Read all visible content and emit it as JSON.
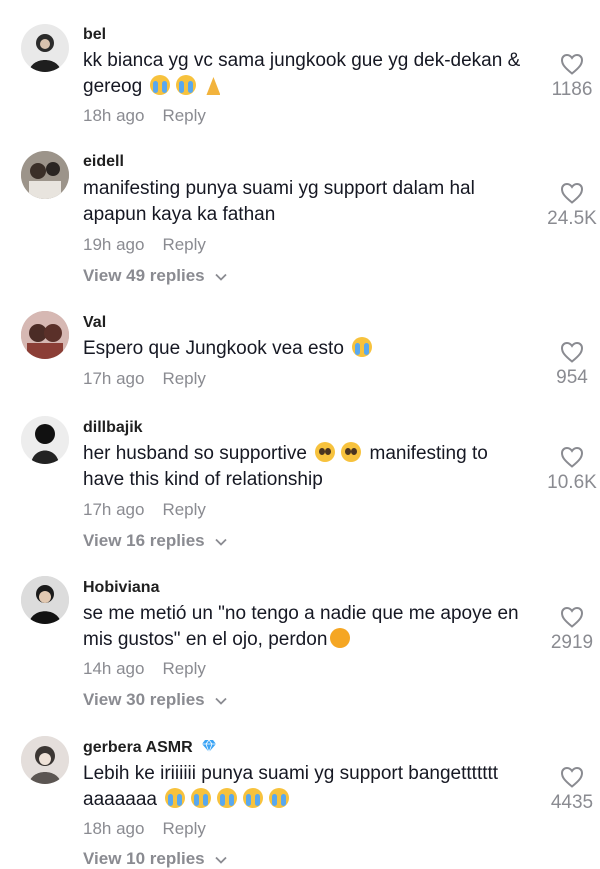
{
  "comments": [
    {
      "username": "bel",
      "text": "kk bianca yg vc sama jungkook gue yg dek-dekan & gereog",
      "emojis": [
        "cry",
        "cry",
        "pray"
      ],
      "time": "18h ago",
      "reply": "Reply",
      "likes": "1186",
      "view_replies": ""
    },
    {
      "username": "eidell",
      "text": "manifesting punya suami yg support dalam hal apapun kaya ka fathan",
      "emojis": [],
      "time": "19h ago",
      "reply": "Reply",
      "likes": "24.5K",
      "view_replies": "View 49 replies"
    },
    {
      "username": "Val",
      "text": "Espero que Jungkook vea esto",
      "emojis": [
        "cry"
      ],
      "time": "17h ago",
      "reply": "Reply",
      "likes": "954",
      "view_replies": ""
    },
    {
      "username": "dillbajik",
      "text_a": "her husband so supportive",
      "text_b": "manifesting to have this kind of relationship",
      "time": "17h ago",
      "reply": "Reply",
      "likes": "10.6K",
      "view_replies": "View 16 replies"
    },
    {
      "username": "Hobiviana",
      "text": "se me metió un \"no tengo a nadie que me apoye en mis gustos\" en el ojo, perdon",
      "emojis": [
        "relieved"
      ],
      "time": "14h ago",
      "reply": "Reply",
      "likes": "2919",
      "view_replies": "View 30 replies"
    },
    {
      "username": "gerbera ASMR",
      "text": "Lebih ke iriiiiii punya suami yg support bangettttttt aaaaaaa",
      "emojis": [
        "cry",
        "cry",
        "cry",
        "cry",
        "cry"
      ],
      "time": "18h ago",
      "reply": "Reply",
      "likes": "4435",
      "view_replies": "View 10 replies"
    }
  ],
  "icons": {
    "like": "heart-outline-icon",
    "chevron": "chevron-down-icon",
    "verified_gem": "diamond-icon"
  },
  "colors": {
    "text": "#161823",
    "meta": "#8a8b91",
    "background": "#ffffff"
  }
}
